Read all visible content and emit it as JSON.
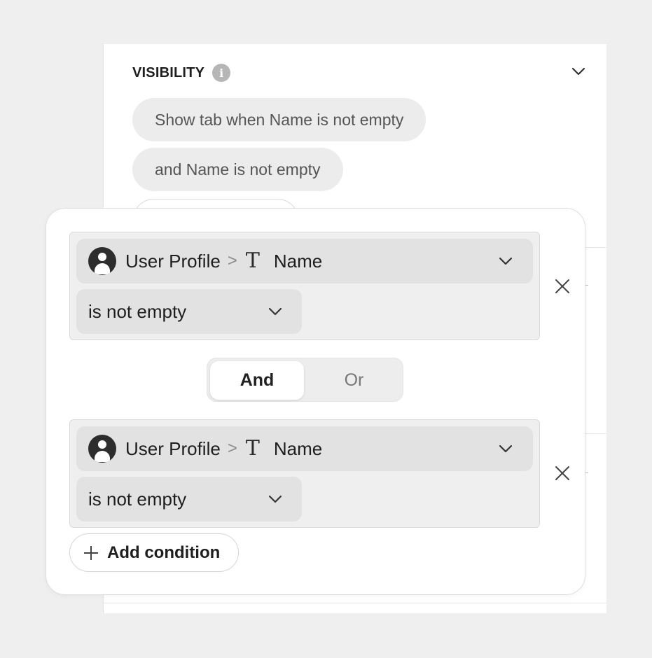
{
  "visibility": {
    "title": "VISIBILITY",
    "info_glyph": "i",
    "rules": [
      "Show tab when Name is not empty",
      "and Name is not empty"
    ]
  },
  "conditions": [
    {
      "source": "User Profile",
      "separator": ">",
      "type_glyph": "T",
      "field": "Name",
      "operator": "is not empty"
    },
    {
      "source": "User Profile",
      "separator": ">",
      "type_glyph": "T",
      "field": "Name",
      "operator": "is not empty"
    }
  ],
  "logic_toggle": {
    "and_label": "And",
    "or_label": "Or",
    "selected": "And"
  },
  "add_condition_label": "Add condition",
  "icons": {
    "info": "info-icon",
    "collapse": "chevron-down-icon",
    "avatar": "user-avatar-icon",
    "text_type": "text-type-icon",
    "remove": "close-icon",
    "add": "plus-icon"
  },
  "colors": {
    "panel_bg": "#ffffff",
    "page_bg": "#efefef",
    "select_bg": "#e2e2e2"
  }
}
